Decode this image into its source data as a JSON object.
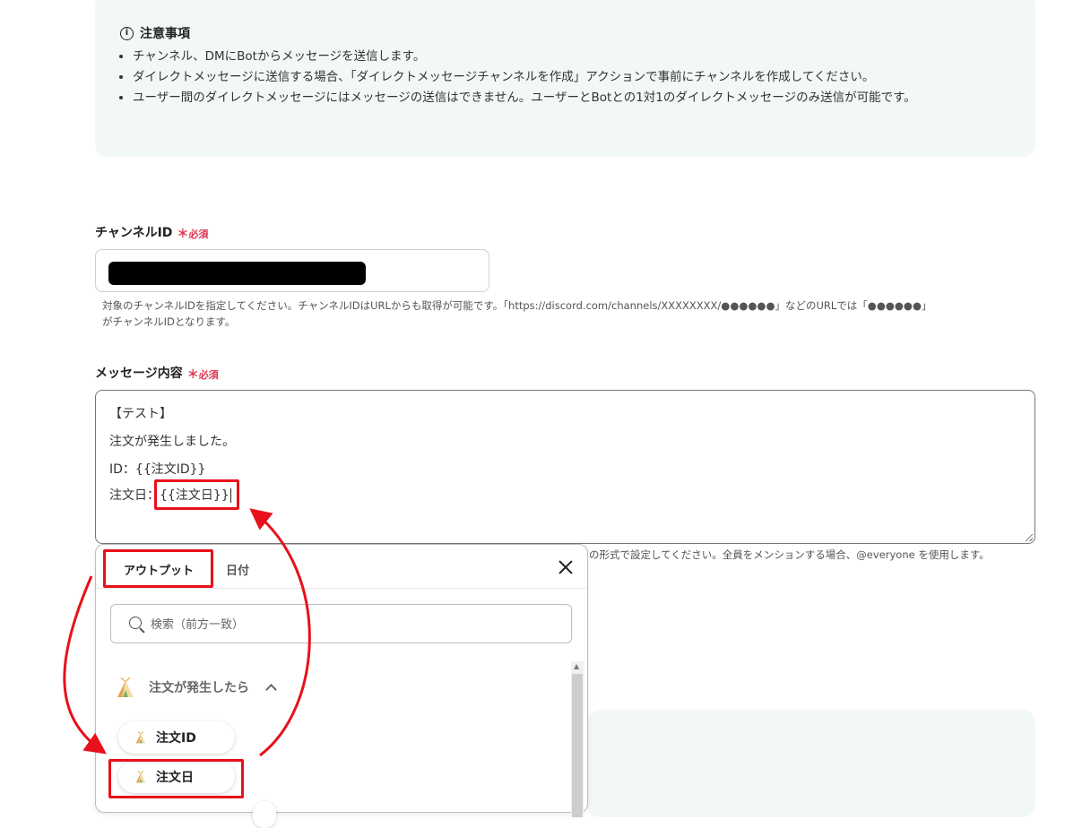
{
  "notice": {
    "title": "注意事項",
    "icon": "info-icon",
    "items": [
      "チャンネル、DMにBotからメッセージを送信します。",
      "ダイレクトメッセージに送信する場合、「ダイレクトメッセージチャンネルを作成」アクションで事前にチャンネルを作成してください。",
      "ユーザー間のダイレクトメッセージにはメッセージの送信はできません。ユーザーとBotとの1対1のダイレクトメッセージのみ送信が可能です。"
    ]
  },
  "channel_field": {
    "label": "チャンネルID",
    "required_mark": "＊",
    "required_text": "必須",
    "help_line1": "対象のチャンネルIDを指定してください。チャンネルIDはURLからも取得が可能です。「https://discord.com/channels/XXXXXXXX/●●●●●●」などのURLでは「●●●●●●」",
    "help_line2": "がチャンネルIDとなります。"
  },
  "message_field": {
    "label": "メッセージ内容",
    "required_mark": "＊",
    "required_text": "必須",
    "lines": [
      "【テスト】",
      "注文が発生しました。",
      "ID：{{注文ID}}",
      "注文日："
    ],
    "inserted_token": "{{注文日}}",
    "help_partial": "の形式で設定してください。全員をメンションする場合、@everyone を使用します。"
  },
  "popup": {
    "tabs": [
      "アウトプット",
      "日付"
    ],
    "active_tab": "アウトプット",
    "search_placeholder": "検索（前方一致）",
    "group": {
      "label": "注文が発生したら",
      "icon": "tent-icon",
      "expanded": true
    },
    "items": [
      "注文ID",
      "注文日"
    ]
  },
  "colors": {
    "highlight": "#e8101a",
    "required": "#e0364f",
    "notice_bg": "#f1f8f7"
  }
}
